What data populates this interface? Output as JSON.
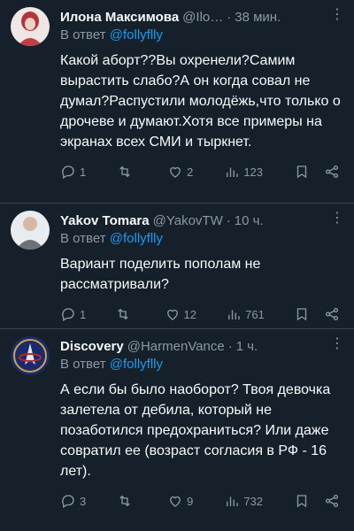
{
  "tweets": [
    {
      "name": "Илона Максимова",
      "handle": "@Ilo…",
      "time": "38 мин.",
      "reply_prefix": "В ответ",
      "reply_to": "@follyflly",
      "text": "Какой аборт??Вы охренели?Самим вырастить слабо?А он когда совал не думал?Распустили молодёжь,что только о дрочеве и думают.Хотя все примеры на экранах всех СМИ и тыркнет.",
      "replies": "1",
      "retweets": "",
      "likes": "2",
      "views": "123"
    },
    {
      "name": "Yakov Tomara",
      "handle": "@YakovTW",
      "time": "10 ч.",
      "reply_prefix": "В ответ",
      "reply_to": "@follyflly",
      "text": "Вариант поделить пополам не рассматривали?",
      "replies": "1",
      "retweets": "",
      "likes": "12",
      "views": "761"
    },
    {
      "name": "Discovery",
      "handle": "@HarmenVance",
      "time": "1 ч.",
      "reply_prefix": "В ответ",
      "reply_to": "@follyflly",
      "text": "А если бы было наоборот? Твоя девочка залетела от дебила, который не позаботился предохраниться? Или даже совратил ее (возраст согласия в РФ - 16 лет).",
      "replies": "3",
      "retweets": "",
      "likes": "9",
      "views": "732"
    }
  ],
  "colors": {
    "background": "#15202b",
    "link": "#1d9bf0",
    "muted": "#8b98a5",
    "text": "#f7f9f9"
  }
}
